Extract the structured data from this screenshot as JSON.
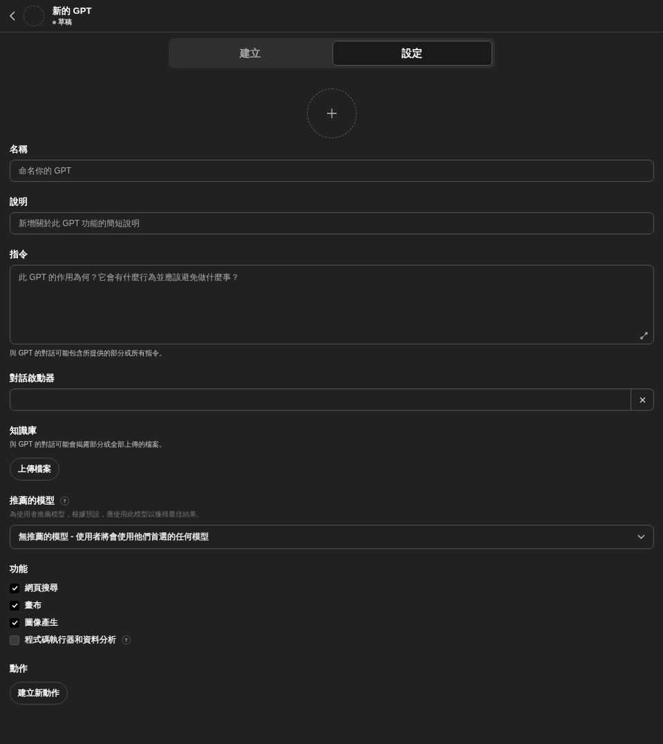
{
  "header": {
    "title": "新的 GPT",
    "status": "草稿"
  },
  "tabs": [
    {
      "label": "建立",
      "selected": false
    },
    {
      "label": "設定",
      "selected": true
    }
  ],
  "name": {
    "label": "名稱",
    "placeholder": "命名你的 GPT"
  },
  "description": {
    "label": "說明",
    "placeholder": "新增關於此 GPT 功能的簡短說明"
  },
  "instructions": {
    "label": "指令",
    "placeholder": "此 GPT 的作用為何？它會有什麼行為並應該避免做什麼事？",
    "note": "與 GPT 的對話可能包含所提供的部分或所有指令。"
  },
  "starters": {
    "label": "對話啟動器"
  },
  "knowledge": {
    "label": "知識庫",
    "note": "與 GPT 的對話可能會揭露部分或全部上傳的檔案。",
    "button": "上傳檔案"
  },
  "model": {
    "label": "推薦的模型",
    "help": "?",
    "note": "為使用者推薦模型，根據預設，應使用此模型以獲得最佳結果。",
    "value": "無推薦的模型 - 使用者將會使用他們首選的任何模型"
  },
  "capabilities": {
    "label": "功能",
    "items": [
      {
        "label": "網頁搜尋",
        "checked": true
      },
      {
        "label": "畫布",
        "checked": true
      },
      {
        "label": "圖像產生",
        "checked": true
      },
      {
        "label": "程式碼執行器和資料分析",
        "checked": false,
        "help": "?"
      }
    ]
  },
  "actions": {
    "label": "動作",
    "button": "建立新動作"
  }
}
